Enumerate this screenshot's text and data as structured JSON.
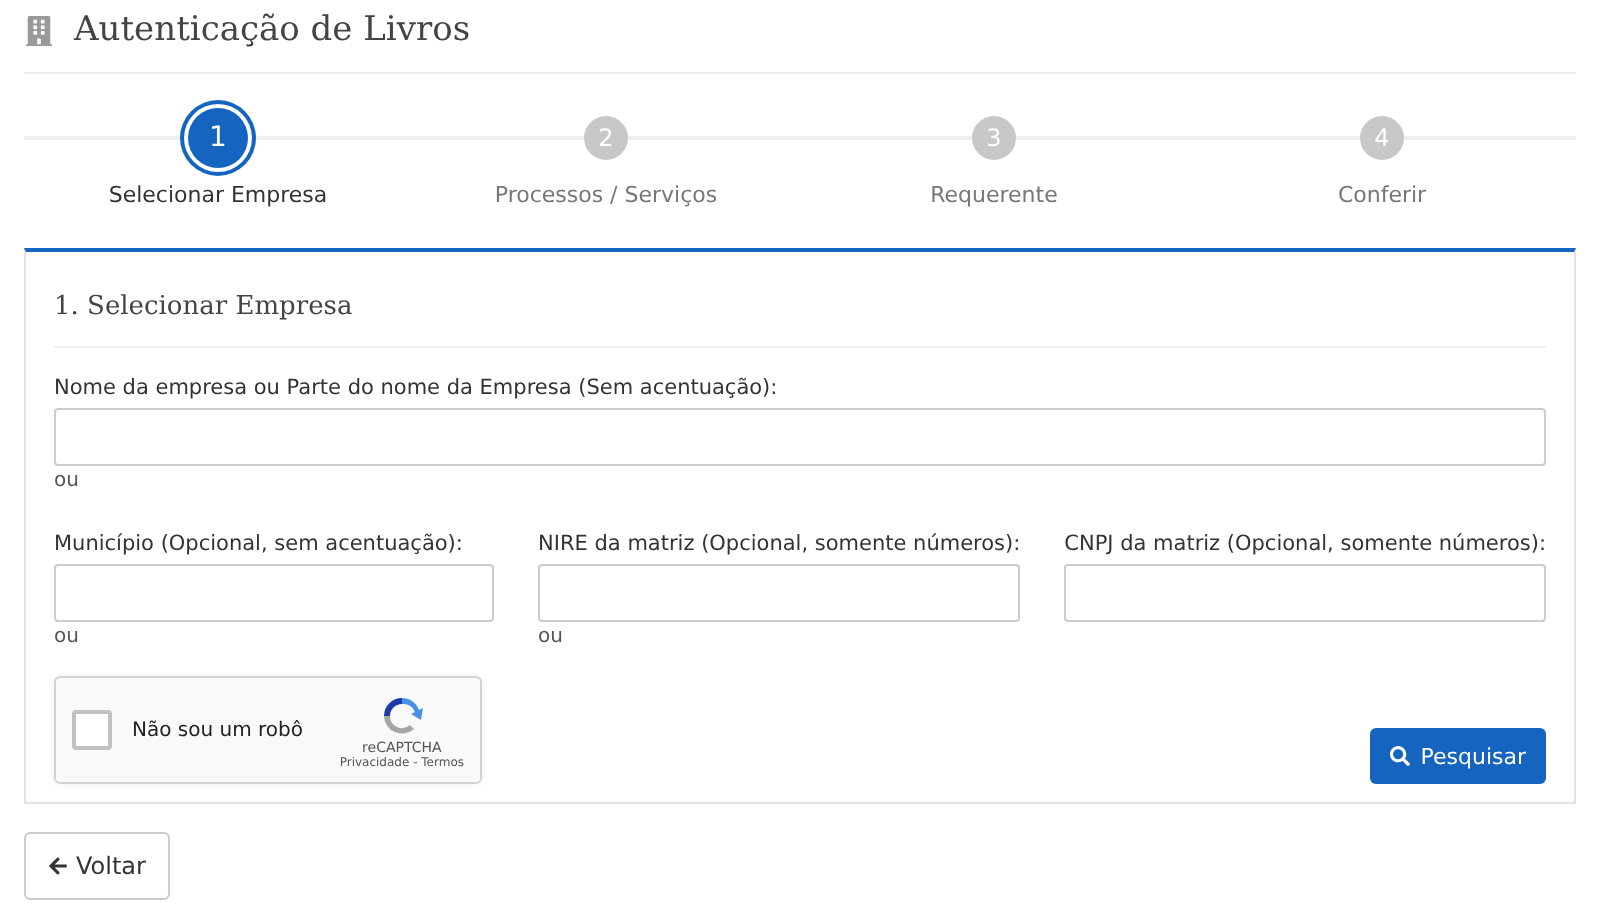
{
  "header": {
    "title": "Autenticação de Livros"
  },
  "steps": [
    {
      "number": "1",
      "label": "Selecionar Empresa",
      "selected": true
    },
    {
      "number": "2",
      "label": "Processos / Serviços",
      "selected": false
    },
    {
      "number": "3",
      "label": "Requerente",
      "selected": false
    },
    {
      "number": "4",
      "label": "Conferir",
      "selected": false
    }
  ],
  "panel": {
    "title": "1. Selecionar Empresa",
    "company_field": {
      "label": "Nome da empresa ou Parte do nome da Empresa (Sem acentuação):",
      "note": "ou"
    },
    "fields": [
      {
        "label": "Município (Opcional, sem acentuação):",
        "note": "ou"
      },
      {
        "label": "NIRE da matriz (Opcional, somente números):",
        "note": "ou"
      },
      {
        "label": "CNPJ da matriz (Opcional, somente números):"
      }
    ],
    "captcha": {
      "label": "Não sou um robô",
      "checked": false,
      "brand": "reCAPTCHA",
      "links": "Privacidade - Termos"
    },
    "search_button": "Pesquisar"
  },
  "back_button": "Voltar"
}
